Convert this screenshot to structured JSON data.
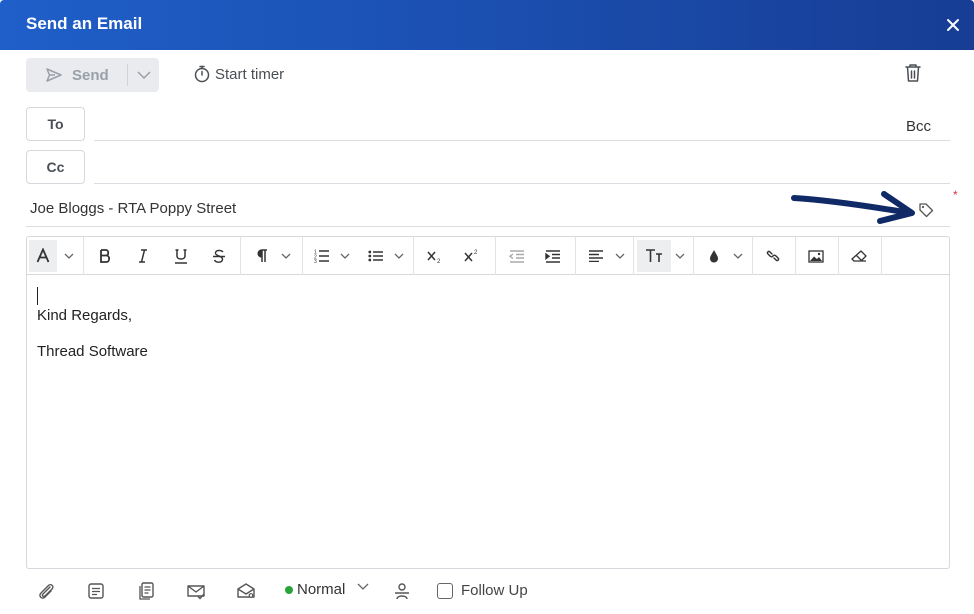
{
  "dialog": {
    "title": "Send an Email"
  },
  "actions": {
    "send_label": "Send",
    "timer_label": "Start timer"
  },
  "recipients": {
    "to_label": "To",
    "cc_label": "Cc",
    "bcc_label": "Bcc",
    "to_value": "",
    "cc_value": ""
  },
  "subject": {
    "value": "Joe Bloggs - RTA Poppy Street",
    "required_marker": "*"
  },
  "toolbar": {
    "items": [
      "font-color",
      "bold",
      "italic",
      "underline",
      "strikethrough",
      "paragraph",
      "ordered-list",
      "unordered-list",
      "subscript",
      "superscript",
      "outdent",
      "indent",
      "align",
      "text-size",
      "highlight",
      "link",
      "image",
      "clear-format"
    ]
  },
  "body": {
    "lines": [
      "Kind Regards,",
      "Thread Software"
    ]
  },
  "footer": {
    "priority_label": "Normal",
    "priority_color": "#2aa33a",
    "follow_up_label": "Follow Up",
    "follow_up_checked": false
  },
  "colors": {
    "header_start": "#1f5fc9",
    "header_end": "#173d94",
    "annotation_arrow": "#0f2a66"
  }
}
